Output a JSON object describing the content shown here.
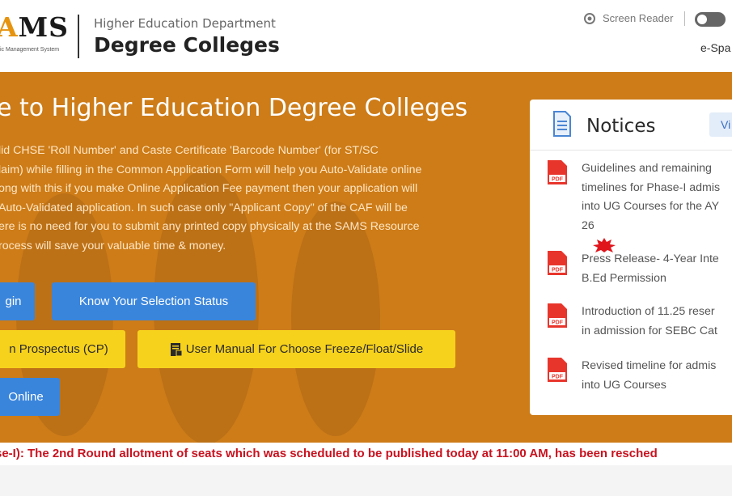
{
  "header": {
    "logo_text_accent": "A",
    "logo_text_rest": "MS",
    "logo_subtitle": "ic Management System",
    "dept_label": "Higher Education Department",
    "dept_title": "Degree Colleges",
    "screen_reader_label": "Screen Reader",
    "espace_label": "e-Spa"
  },
  "hero": {
    "welcome": "e to Higher Education Degree Colleges",
    "intro_lines": [
      "lid CHSE 'Roll Number' and Caste Certificate 'Barcode Number' (for ST/SC",
      "laim) while filling in the Common Application Form will help you Auto-Validate online",
      "ong with this if you make Online Application Fee payment then your application will",
      "Auto-Validated application. In such case only \"Applicant Copy\" of the CAF will be",
      "ere is no need for you to submit any printed copy physically at the SAMS Resource",
      "rocess will save your valuable time & money."
    ],
    "buttons": {
      "login": "gin",
      "selection_status": "Know Your Selection Status",
      "prospectus": "n Prospectus (CP)",
      "user_manual": "User Manual For Choose Freeze/Float/Slide",
      "online": "Online"
    }
  },
  "notices": {
    "title": "Notices",
    "view_label": "Vi",
    "items": [
      {
        "lines": [
          "Guidelines and remaining",
          "timelines for Phase-I admis",
          "into UG Courses for the AY",
          "26"
        ],
        "is_new": true
      },
      {
        "lines": [
          "Press Release- 4-Year Inte",
          "B.Ed Permission"
        ],
        "is_new": false
      },
      {
        "lines": [
          "Introduction of 11.25 reser",
          "in admission for SEBC Cat"
        ],
        "is_new": false
      },
      {
        "lines": [
          "Revised timeline for admis",
          "into UG Courses"
        ],
        "is_new": false
      }
    ]
  },
  "ticker": {
    "text": "se-I): The 2nd Round allotment of seats which was scheduled to be published today at 11:00 AM, has been resched"
  },
  "colors": {
    "hero_bg": "#cd7c18",
    "button_blue": "#3a85dc",
    "button_yellow": "#f7d21c",
    "ticker_red": "#c8121f",
    "logo_accent": "#e69410"
  },
  "icons": [
    "screen-reader-icon",
    "notices-doc-icon",
    "pdf-icon",
    "new-badge-icon",
    "manual-doc-icon"
  ]
}
